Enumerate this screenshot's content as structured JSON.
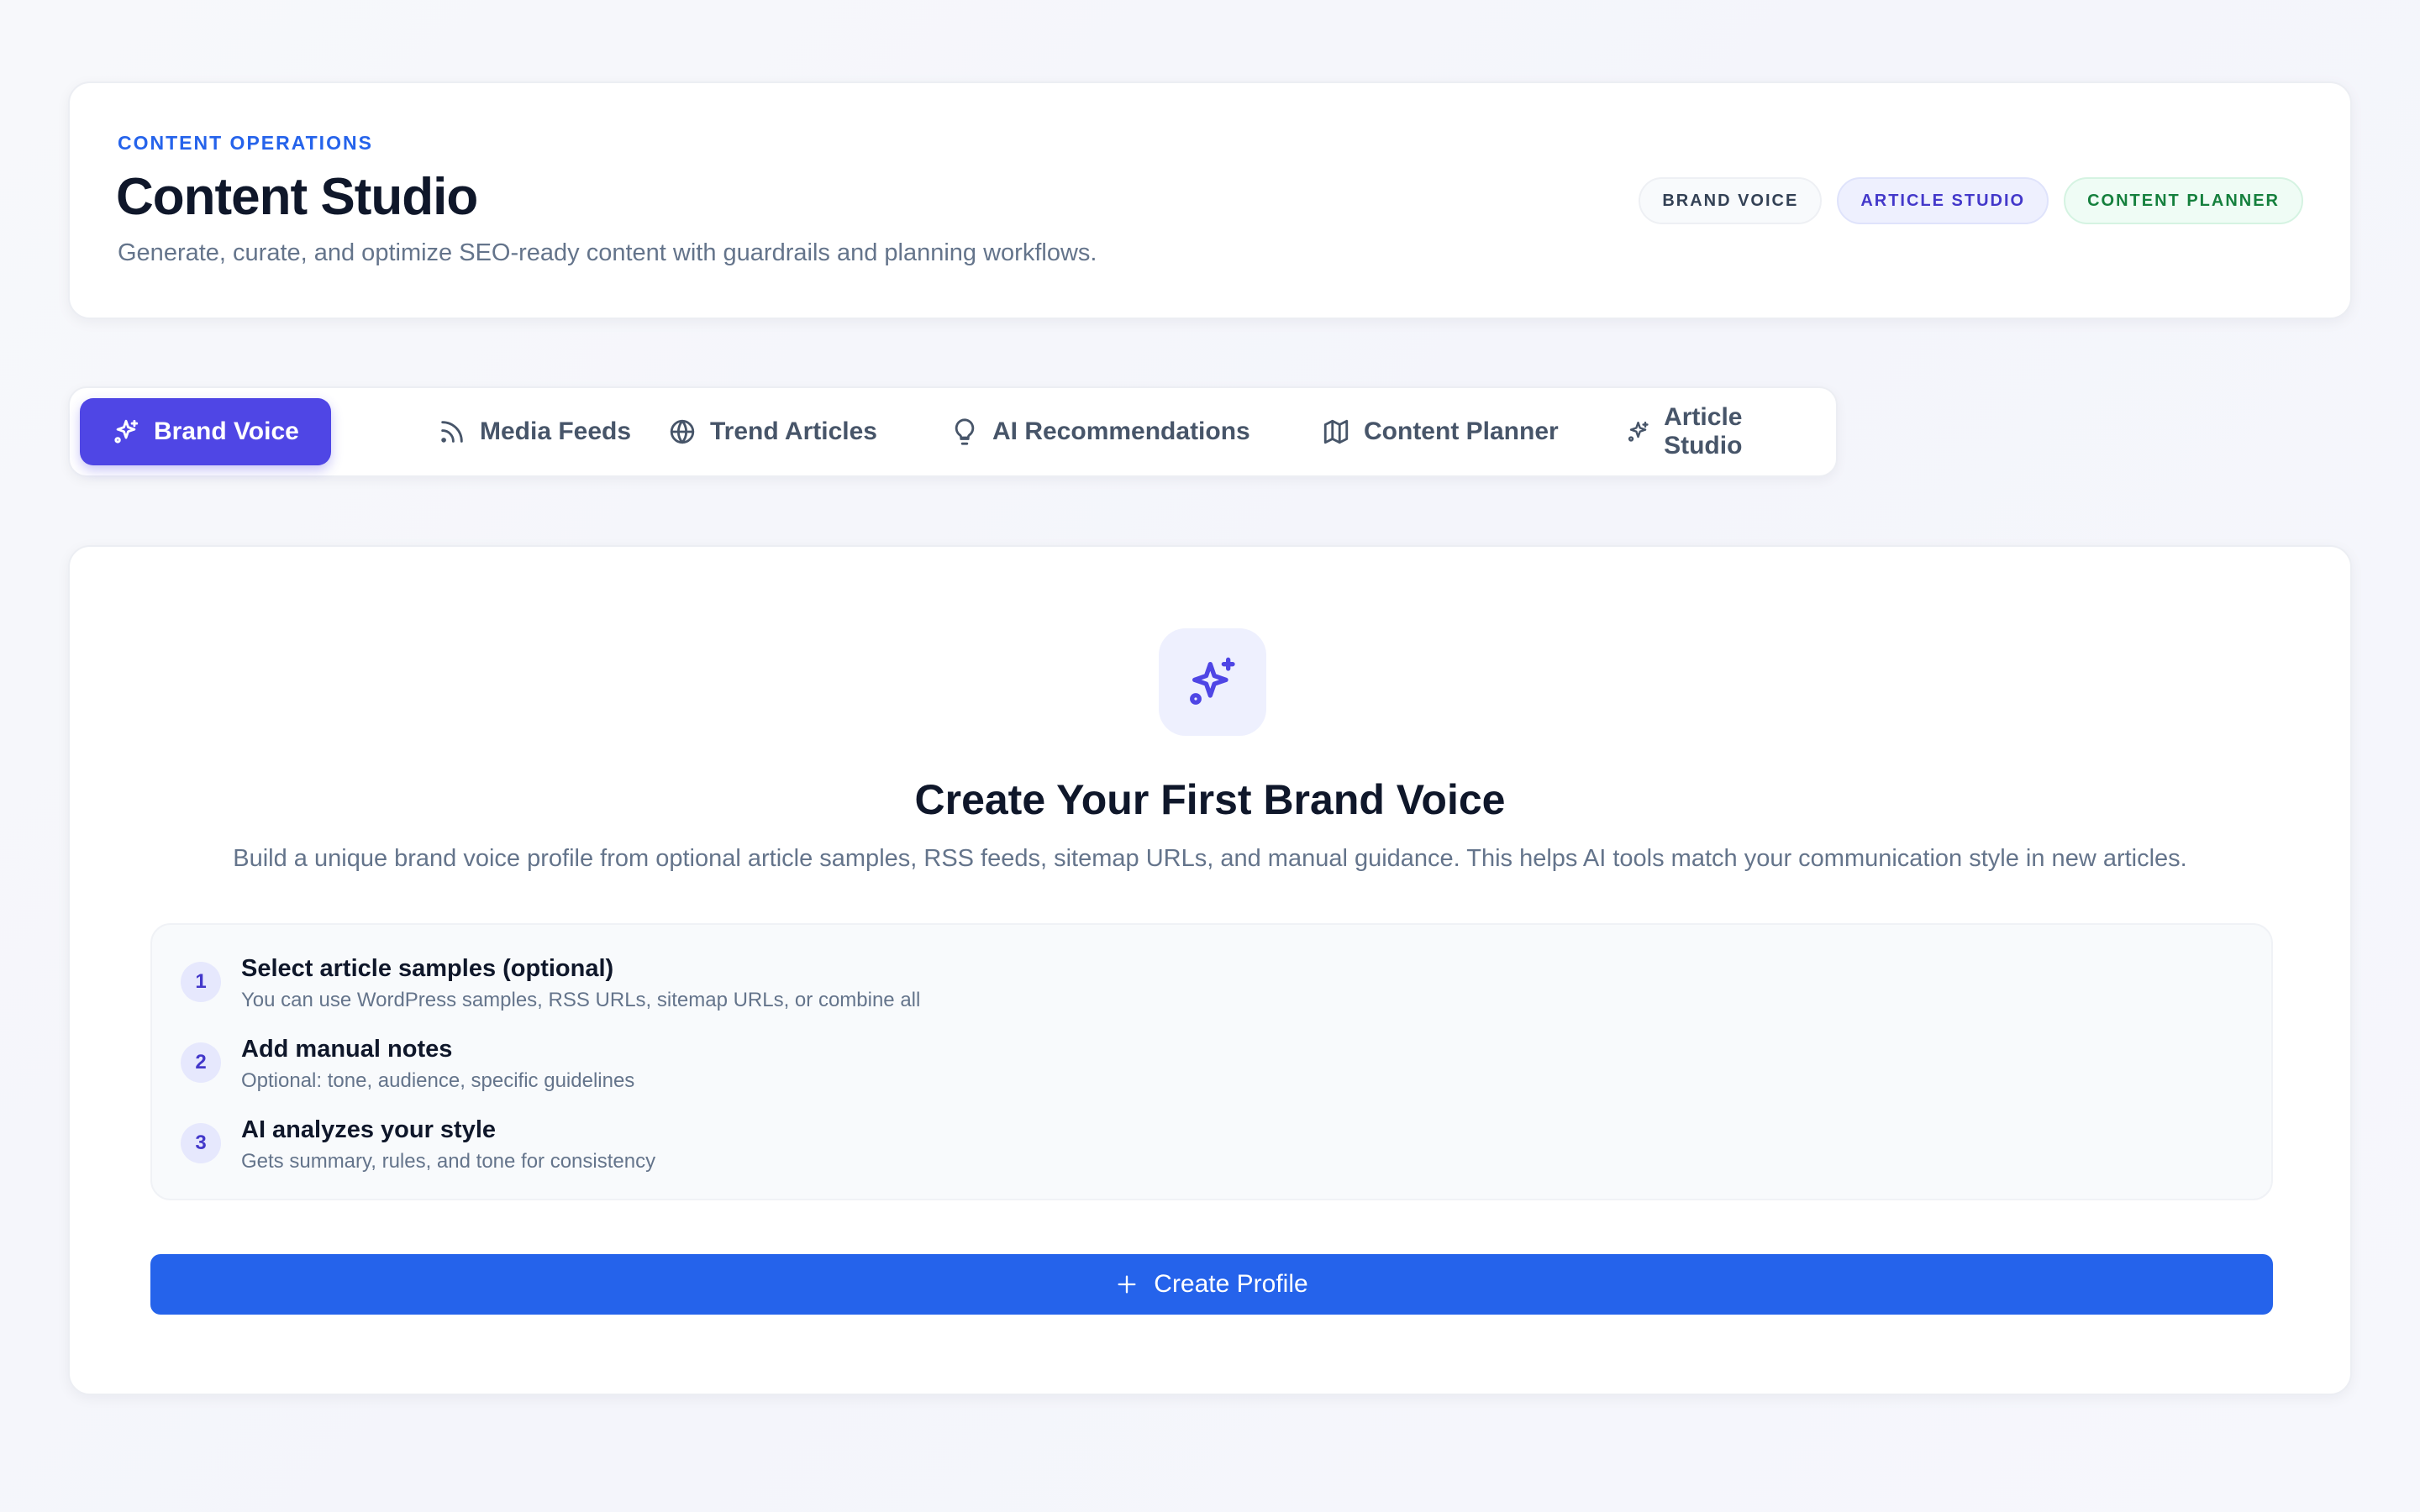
{
  "header": {
    "eyebrow": "CONTENT OPERATIONS",
    "title": "Content Studio",
    "subtitle": "Generate, curate, and optimize SEO-ready content with guardrails and planning workflows.",
    "badges": [
      "BRAND VOICE",
      "ARTICLE STUDIO",
      "CONTENT PLANNER"
    ]
  },
  "tabs": [
    {
      "label": "Brand Voice",
      "icon": "sparkles-icon",
      "active": true
    },
    {
      "label": "Media Feeds",
      "icon": "rss-icon",
      "active": false
    },
    {
      "label": "Trend Articles",
      "icon": "globe-icon",
      "active": false
    },
    {
      "label": "AI Recommendations",
      "icon": "lightbulb-icon",
      "active": false
    },
    {
      "label": "Content Planner",
      "icon": "map-icon",
      "active": false
    },
    {
      "label": "Article Studio",
      "icon": "sparkles-icon",
      "active": false
    }
  ],
  "empty_state": {
    "icon": "sparkles-icon",
    "title": "Create Your First Brand Voice",
    "description": "Build a unique brand voice profile from optional article samples, RSS feeds, sitemap URLs, and manual guidance. This helps AI tools match your communication style in new articles.",
    "steps": [
      {
        "number": "1",
        "title": "Select article samples (optional)",
        "description": "You can use WordPress samples, RSS URLs, sitemap URLs, or combine all"
      },
      {
        "number": "2",
        "title": "Add manual notes",
        "description": "Optional: tone, audience, specific guidelines"
      },
      {
        "number": "3",
        "title": "AI analyzes your style",
        "description": "Gets summary, rules, and tone for consistency"
      }
    ],
    "button_label": "Create Profile"
  },
  "colors": {
    "accent": "#4f46e5",
    "primary_button": "#2563eb",
    "eyebrow": "#2563eb"
  }
}
